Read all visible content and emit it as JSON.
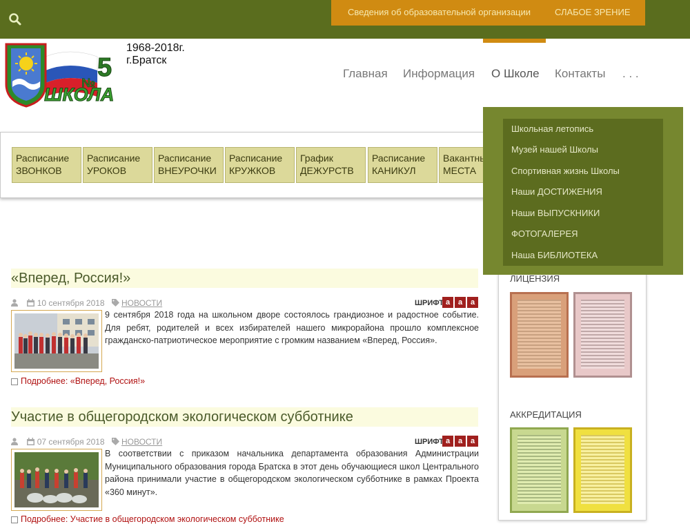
{
  "topbar": {
    "info_link": "Сведения об образовательной организации",
    "vision_link": "СЛАБОЕ ЗРЕНИЕ"
  },
  "header": {
    "years": "1968-2018г.",
    "city": "г.Братск",
    "logo_number": "5",
    "logo_no": "№",
    "logo_text": "ШКОЛА"
  },
  "nav": {
    "items": [
      {
        "label": "Главная"
      },
      {
        "label": "Информация"
      },
      {
        "label": "О Школе"
      },
      {
        "label": "Контакты"
      },
      {
        "label": ". . ."
      }
    ]
  },
  "schedule": {
    "buttons": [
      {
        "line1": "Расписание",
        "line2": "ЗВОНКОВ"
      },
      {
        "line1": "Расписание",
        "line2": "УРОКОВ"
      },
      {
        "line1": "Расписание",
        "line2": "ВНЕУРОЧКИ"
      },
      {
        "line1": "Расписание",
        "line2": "КРУЖКОВ"
      },
      {
        "line1": "График",
        "line2": "ДЕЖУРСТВ"
      },
      {
        "line1": "Расписание",
        "line2": "КАНИКУЛ"
      },
      {
        "line1": "Вакантные",
        "line2": "МЕСТА"
      }
    ]
  },
  "dropdown": {
    "items": [
      {
        "label": "Школьная летопись"
      },
      {
        "label": "Музей нашей Школы"
      },
      {
        "label": "Спортивная жизнь Школы"
      },
      {
        "label": "Наши ДОСТИЖЕНИЯ"
      },
      {
        "label": "Наши ВЫПУСКНИКИ"
      },
      {
        "label": "ФОТОГАЛЕРЕЯ"
      },
      {
        "label": "Наша БИБЛИОТЕКА"
      }
    ]
  },
  "articles": [
    {
      "title": "«Вперед, Россия!»",
      "date": "10 сентября 2018",
      "category": "НОВОСТИ",
      "font_label": "ШРИФТ:",
      "text": "9 сентября 2018 года на школьном дворе состоялось грандиозное и радостное событие. Для ребят, родителей и всех избирателей нашего микрорайона прошло комплексное гражданско-патриотическое мероприятие с громким названием «Вперед, Россия».",
      "more": "Подробнее: «Вперед, Россия!»"
    },
    {
      "title": "Участие в общегородском экологическом субботнике",
      "date": "07 сентября 2018",
      "category": "НОВОСТИ",
      "font_label": "ШРИФТ:",
      "text": "В соответствии с приказом начальника департамента образования Администрации Муниципального образования города Братска в этот день обучающиеся школ Центрального района принимали участие в общегородском экологическом субботнике в рамках Проекта «360 минут».",
      "more": "Подробнее: Участие в общегородском экологическом субботнике"
    }
  ],
  "font_buttons": [
    "a",
    "a",
    "a"
  ],
  "sidebar": {
    "license": "ЛИЦЕНЗИЯ",
    "accreditation": "АККРЕДИТАЦИЯ"
  },
  "colors": {
    "topbar": "#5a6d1e",
    "accent": "#d08b12",
    "dropdown": "#5c6c1f"
  }
}
